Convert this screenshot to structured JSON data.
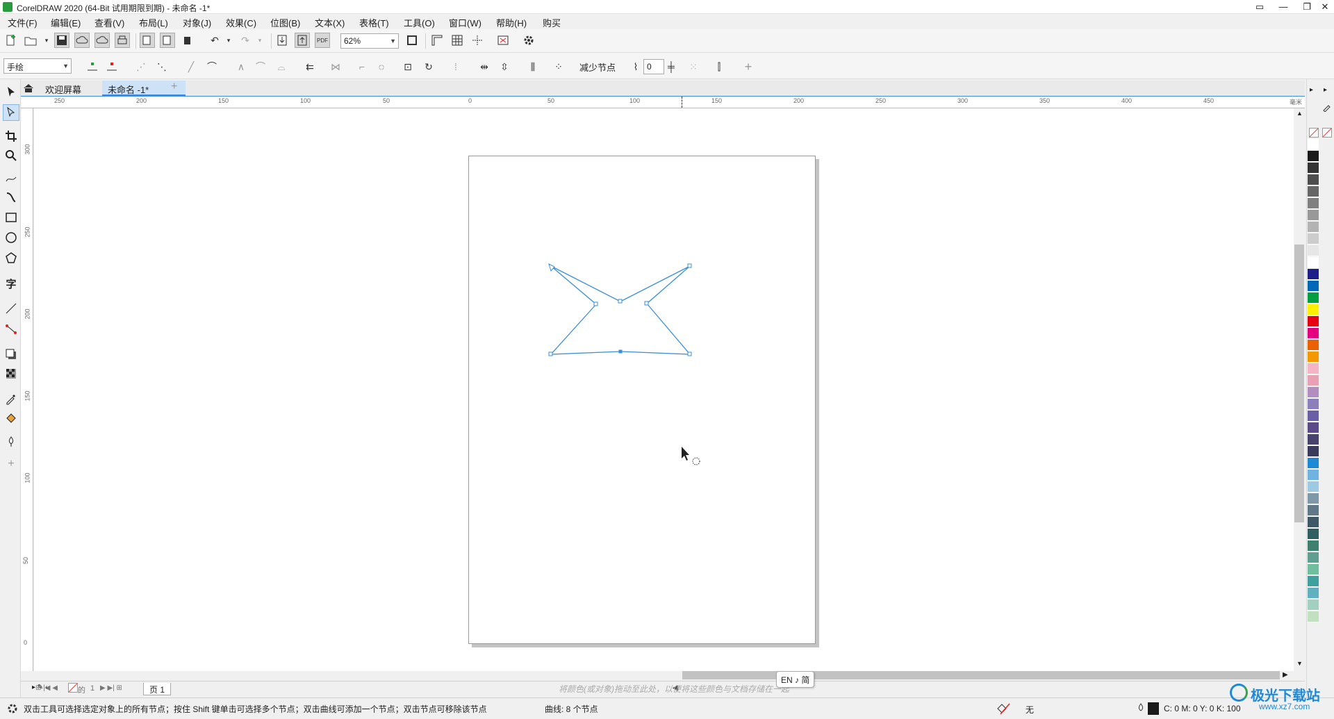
{
  "window": {
    "title": "CorelDRAW 2020 (64-Bit 试用期限到期) - 未命名 -1*",
    "controls": [
      "▭",
      "—",
      "❐",
      "✕"
    ]
  },
  "menu": [
    "文件(F)",
    "编辑(E)",
    "查看(V)",
    "布局(L)",
    "对象(J)",
    "效果(C)",
    "位图(B)",
    "文本(X)",
    "表格(T)",
    "工具(O)",
    "窗口(W)",
    "帮助(H)",
    "购买"
  ],
  "toolbar": {
    "zoom_value": "62%",
    "reduce_nodes_label": "减少节点",
    "curve_smoothness_value": "0"
  },
  "property_bar": {
    "selection_mode": "手绘"
  },
  "tabs": {
    "welcome": "欢迎屏幕",
    "document": "未命名 -1*",
    "add": "+"
  },
  "ruler": {
    "h_ticks": [
      "250",
      "200",
      "150",
      "100",
      "50",
      "0",
      "50",
      "100",
      "150",
      "200",
      "250",
      "300",
      "350",
      "400",
      "450"
    ],
    "unit": "毫米",
    "v_ticks": [
      "300",
      "250",
      "200",
      "150",
      "100",
      "50",
      "0"
    ]
  },
  "docbar": {
    "page_current": "1",
    "page_of_label": "的",
    "page_total": "1",
    "page_tab": "页 1",
    "palette_hint": "将颜色(或对象)拖动至此处，以便将这些颜色与文档存储在一起"
  },
  "ime": {
    "text": "EN ♪ 简"
  },
  "status": {
    "hint": "双击工具可选择选定对象上的所有节点；按住 Shift 键单击可选择多个节点；双击曲线可添加一个节点；双击节点可移除该节点",
    "curve_info": "曲线:  8 个节点",
    "fill_label": "无",
    "color_values": "C: 0 M: 0 Y: 0 K: 100"
  },
  "watermark": {
    "title": "极光下载站",
    "url": "www.xz7.com"
  },
  "palette_colors": [
    "#ffffff",
    "#1a1a1a",
    "#333333",
    "#4d4d4d",
    "#666666",
    "#808080",
    "#999999",
    "#b3b3b3",
    "#cccccc",
    "#e6e6e6",
    "#ffffff",
    "#1d2088",
    "#0068b7",
    "#00a040",
    "#fff100",
    "#e60012",
    "#e4007f",
    "#eb6100",
    "#f39800",
    "#f4b4c6",
    "#e8a0b4",
    "#b28ec0",
    "#8c7fba",
    "#6a5ea6",
    "#5a4a8a",
    "#48426e",
    "#3a3a5a",
    "#1e8ad6",
    "#6fb4e0",
    "#9ec9e2",
    "#7f98a8",
    "#5f7888",
    "#3f5868",
    "#2f5f5f",
    "#3f7f6f",
    "#5f9f8f",
    "#6fbf9f",
    "#3fa0a0",
    "#60b0c0",
    "#a0d0c0",
    "#c0e0c0"
  ],
  "shape": {
    "stroke": "#3a8fd6"
  }
}
